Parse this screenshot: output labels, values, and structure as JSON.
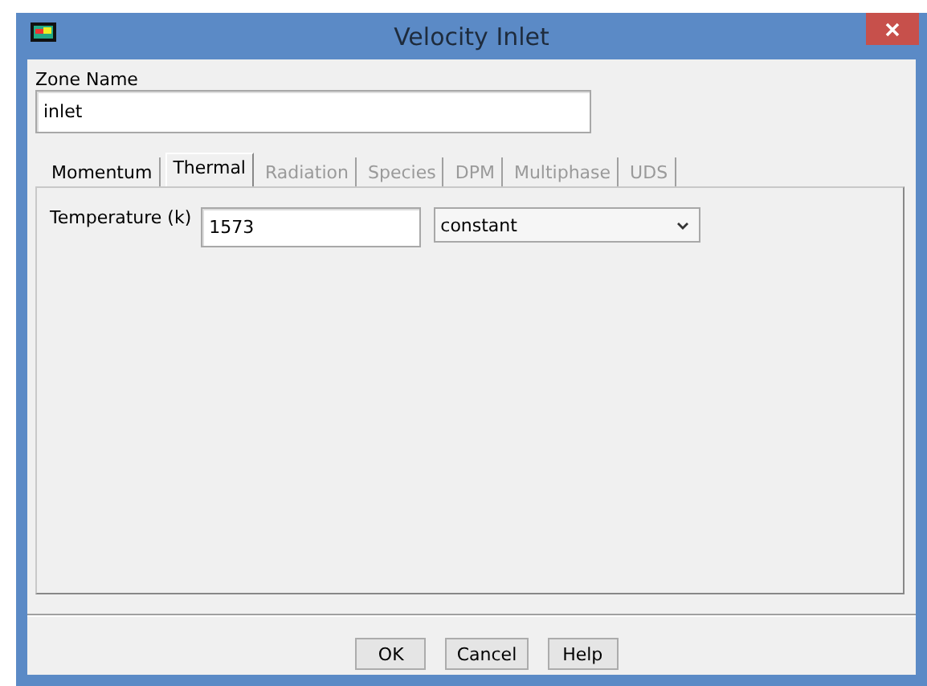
{
  "window": {
    "title": "Velocity Inlet"
  },
  "zone_name": {
    "label": "Zone Name",
    "value": "inlet"
  },
  "tabs": [
    {
      "label": "Momentum",
      "selected": false,
      "disabled": false
    },
    {
      "label": "Thermal",
      "selected": true,
      "disabled": false
    },
    {
      "label": "Radiation",
      "selected": false,
      "disabled": true
    },
    {
      "label": "Species",
      "selected": false,
      "disabled": true
    },
    {
      "label": "DPM",
      "selected": false,
      "disabled": true
    },
    {
      "label": "Multiphase",
      "selected": false,
      "disabled": true
    },
    {
      "label": "UDS",
      "selected": false,
      "disabled": true
    }
  ],
  "temperature": {
    "label": "Temperature (k)",
    "value": "1573",
    "method": "constant"
  },
  "buttons": [
    "OK",
    "Cancel",
    "Help"
  ]
}
